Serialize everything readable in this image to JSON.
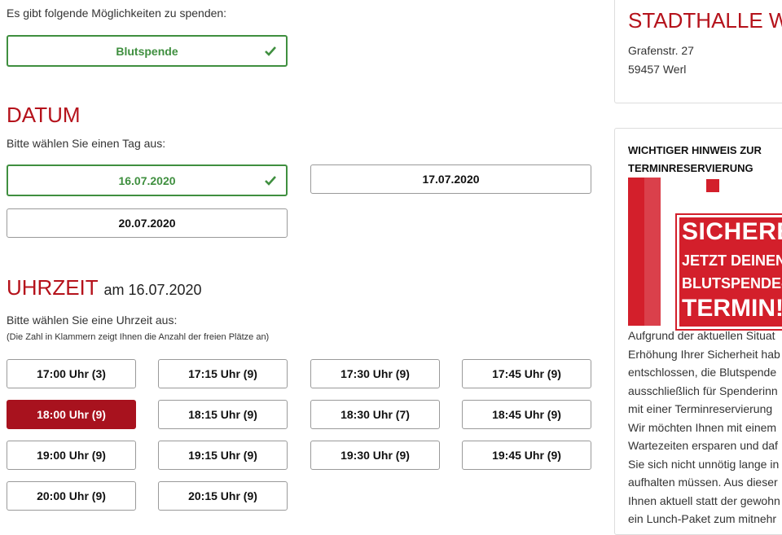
{
  "donation": {
    "intro": "Es gibt folgende Möglichkeiten zu spenden:",
    "option_label": "Blutspende"
  },
  "datum": {
    "title": "DATUM",
    "instruction": "Bitte wählen Sie einen Tag aus:",
    "dates": [
      "16.07.2020",
      "17.07.2020",
      "20.07.2020"
    ],
    "selected": "16.07.2020"
  },
  "uhrzeit": {
    "title": "UHRZEIT",
    "date_suffix": "am 16.07.2020",
    "instruction": "Bitte wählen Sie eine Uhrzeit aus:",
    "note": "(Die Zahl in Klammern zeigt Ihnen die Anzahl der freien Plätze an)",
    "slots": [
      "17:00 Uhr (3)",
      "17:15 Uhr (9)",
      "17:30 Uhr (9)",
      "17:45 Uhr (9)",
      "18:00 Uhr (9)",
      "18:15 Uhr (9)",
      "18:30 Uhr (7)",
      "18:45 Uhr (9)",
      "19:00 Uhr (9)",
      "19:15 Uhr (9)",
      "19:30 Uhr (9)",
      "19:45 Uhr (9)",
      "20:00 Uhr (9)",
      "20:15 Uhr (9)"
    ],
    "active_slot": "18:00 Uhr (9)"
  },
  "venue": {
    "name": "STADTHALLE WI",
    "street": "Grafenstr. 27",
    "city": "59457 Werl"
  },
  "notice": {
    "title": "WICHTIGER HINWEIS ZUR TERMINRESERVIERUNG",
    "banner_lines": [
      "SICHERE",
      "JETZT DEINEN",
      "BLUTSPENDE-",
      "TERMIN!"
    ],
    "body_lines": [
      "Aufgrund der aktuellen Situat",
      "Erhöhung Ihrer Sicherheit hab",
      "entschlossen, die Blutspende",
      "ausschließlich für Spenderinn",
      "mit einer Terminreservierung",
      "Wir möchten Ihnen mit einem",
      "Wartezeiten ersparen und daf",
      "Sie sich nicht unnötig lange in",
      "aufhalten müssen. Aus dieser",
      "Ihnen aktuell statt der gewohn",
      "ein Lunch-Paket zum mitnehr"
    ]
  },
  "colors": {
    "brand_red": "#b5121b",
    "selected_green": "#3f8f3f",
    "active_red": "#a8121e"
  }
}
